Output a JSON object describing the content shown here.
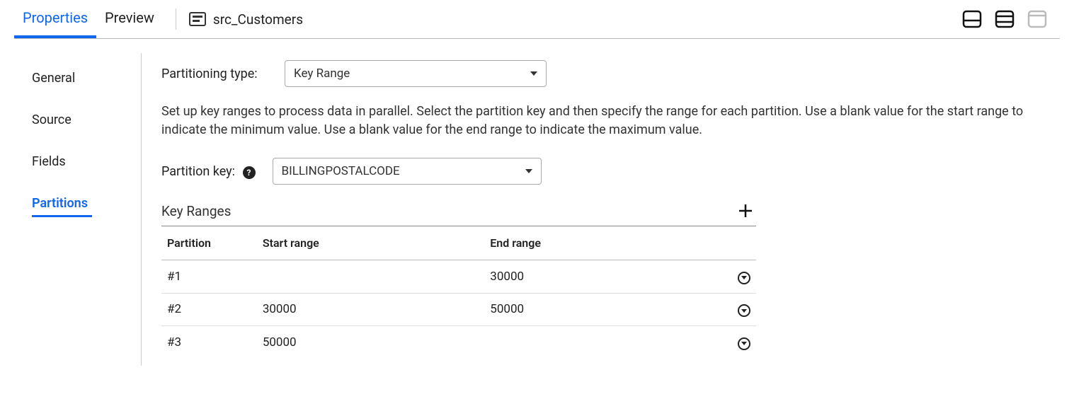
{
  "header": {
    "tabs": [
      {
        "id": "properties",
        "label": "Properties",
        "active": true
      },
      {
        "id": "preview",
        "label": "Preview",
        "active": false
      }
    ],
    "object_name": "src_Customers"
  },
  "side_tabs": [
    {
      "id": "general",
      "label": "General",
      "active": false
    },
    {
      "id": "source",
      "label": "Source",
      "active": false
    },
    {
      "id": "fields",
      "label": "Fields",
      "active": false
    },
    {
      "id": "partitions",
      "label": "Partitions",
      "active": true
    }
  ],
  "form": {
    "partitioning_type_label": "Partitioning type:",
    "partitioning_type_value": "Key Range",
    "description": "Set up key ranges to process data in parallel. Select the partition key and then specify the range for each partition. Use a blank value for the start range to indicate the minimum value. Use a blank value for the end range to indicate the maximum value.",
    "partition_key_label": "Partition key:",
    "partition_key_value": "BILLINGPOSTALCODE"
  },
  "key_ranges": {
    "title": "Key Ranges",
    "columns": {
      "partition": "Partition",
      "start": "Start range",
      "end": "End range"
    },
    "rows": [
      {
        "partition": "#1",
        "start": "",
        "end": "30000"
      },
      {
        "partition": "#2",
        "start": "30000",
        "end": "50000"
      },
      {
        "partition": "#3",
        "start": "50000",
        "end": ""
      }
    ]
  }
}
